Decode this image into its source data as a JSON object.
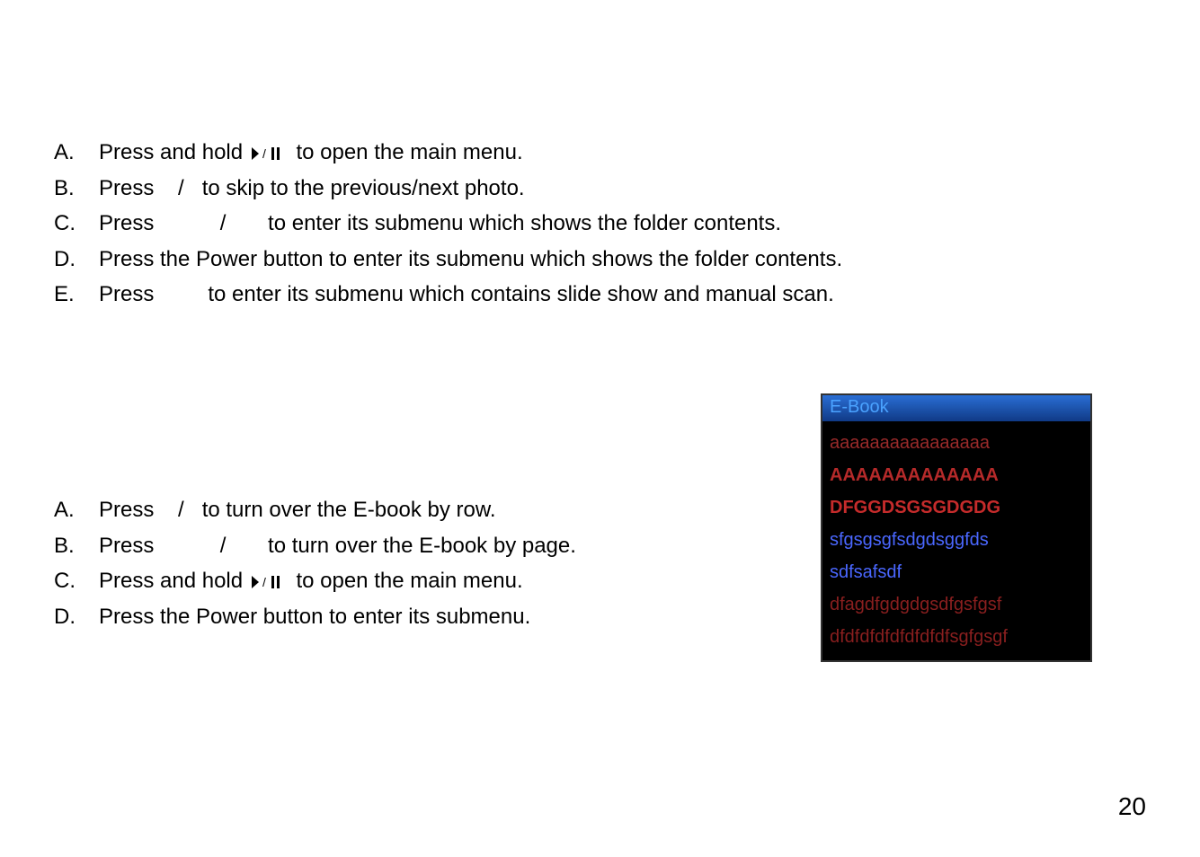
{
  "section1": {
    "items": [
      {
        "letter": "A.",
        "pre": "Press and hold ",
        "icon": "play-pause",
        "post": " to open the main menu."
      },
      {
        "letter": "B.",
        "pre": "Press    /   to skip to the previous/next photo."
      },
      {
        "letter": "C.",
        "pre": "Press           /       to enter its submenu which shows the folder contents."
      },
      {
        "letter": "D.",
        "pre": "Press the Power button to enter its submenu which shows the folder contents."
      },
      {
        "letter": "E.",
        "pre": "Press         to enter its submenu which contains slide show and manual scan."
      }
    ]
  },
  "section2": {
    "items": [
      {
        "letter": "A.",
        "pre": "Press    /   to turn over the E-book by row."
      },
      {
        "letter": "B.",
        "pre": "Press           /       to turn over the E-book by page."
      },
      {
        "letter": "C.",
        "pre": "Press and hold ",
        "icon": "play-pause",
        "post": " to open the main menu."
      },
      {
        "letter": "D.",
        "pre": "Press the Power button to enter its submenu."
      }
    ]
  },
  "device": {
    "header": "E-Book",
    "lines": [
      {
        "text": "aaaaaaaaaaaaaaaa",
        "color": "#9a2a2a",
        "bold": false
      },
      {
        "text": "AAAAAAAAAAAAA",
        "color": "#b52a2a",
        "bold": true
      },
      {
        "text": "DFGGDSGSGDGDG",
        "color": "#c52b2b",
        "bold": true
      },
      {
        "text": "sfgsgsgfsdgdsggfds",
        "color": "#4a67ff",
        "bold": false
      },
      {
        "text": "sdfsafsdf",
        "color": "#4a67ff",
        "bold": false
      },
      {
        "text": "dfagdfgdgdgsdfgsfgsf",
        "color": "#8a1f1f",
        "bold": false
      },
      {
        "text": "dfdfdfdfdfdfdfdfsgfgsgf",
        "color": "#8a1f1f",
        "bold": false
      }
    ]
  },
  "page_number": "20"
}
